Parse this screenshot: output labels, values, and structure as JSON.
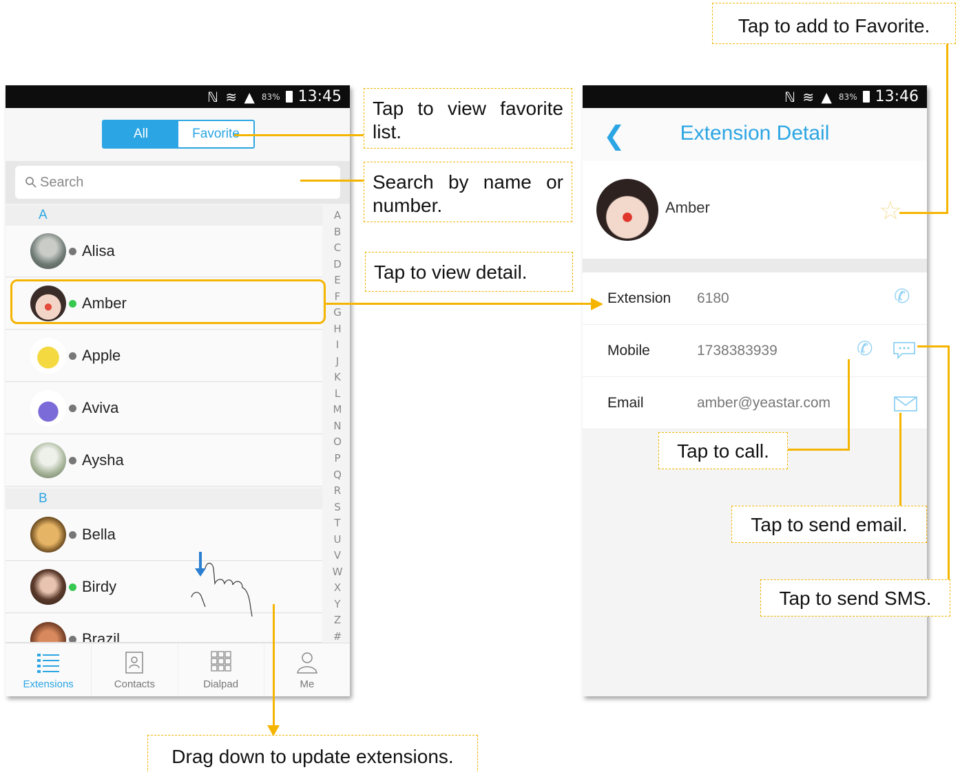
{
  "phone1": {
    "status": {
      "battery": "83%",
      "time": "13:45"
    },
    "segments": [
      {
        "label": "All"
      },
      {
        "label": "Favorite"
      }
    ],
    "search_placeholder": "Search",
    "sections": [
      "A",
      "B"
    ],
    "rows": [
      {
        "name": "Alisa",
        "status": "offline"
      },
      {
        "name": "Amber",
        "status": "online"
      },
      {
        "name": "Apple",
        "status": "offline"
      },
      {
        "name": "Aviva",
        "status": "offline"
      },
      {
        "name": "Aysha",
        "status": "offline"
      },
      {
        "name": "Bella",
        "status": "offline"
      },
      {
        "name": "Birdy",
        "status": "online"
      },
      {
        "name": "Brazil",
        "status": "offline"
      }
    ],
    "alphabet": [
      "A",
      "B",
      "C",
      "D",
      "E",
      "F",
      "G",
      "H",
      "I",
      "J",
      "K",
      "L",
      "M",
      "N",
      "O",
      "P",
      "Q",
      "R",
      "S",
      "T",
      "U",
      "V",
      "W",
      "X",
      "Y",
      "Z",
      "#"
    ],
    "tabs": [
      {
        "label": "Extensions",
        "icon": "list-icon"
      },
      {
        "label": "Contacts",
        "icon": "contacts-icon"
      },
      {
        "label": "Dialpad",
        "icon": "dialpad-icon"
      },
      {
        "label": "Me",
        "icon": "person-icon"
      }
    ]
  },
  "phone2": {
    "status": {
      "battery": "83%",
      "time": "13:46"
    },
    "title": "Extension Detail",
    "name": "Amber",
    "details": [
      {
        "label": "Extension",
        "value": "6180"
      },
      {
        "label": "Mobile",
        "value": "1738383939"
      },
      {
        "label": "Email",
        "value": "amber@yeastar.com"
      }
    ]
  },
  "callouts": {
    "favorite_list": "Tap to view favorite list.",
    "search": "Search by name or number.",
    "detail": "Tap to view detail.",
    "drag": "Drag down to update extensions.",
    "add_favorite": "Tap to add to Favorite.",
    "call": "Tap to call.",
    "email": "Tap to send email.",
    "sms": "Tap to send SMS."
  },
  "colors": {
    "accent": "#2ba5e3",
    "online": "#36c850",
    "offline": "#777777",
    "annotation": "#f5b400"
  }
}
